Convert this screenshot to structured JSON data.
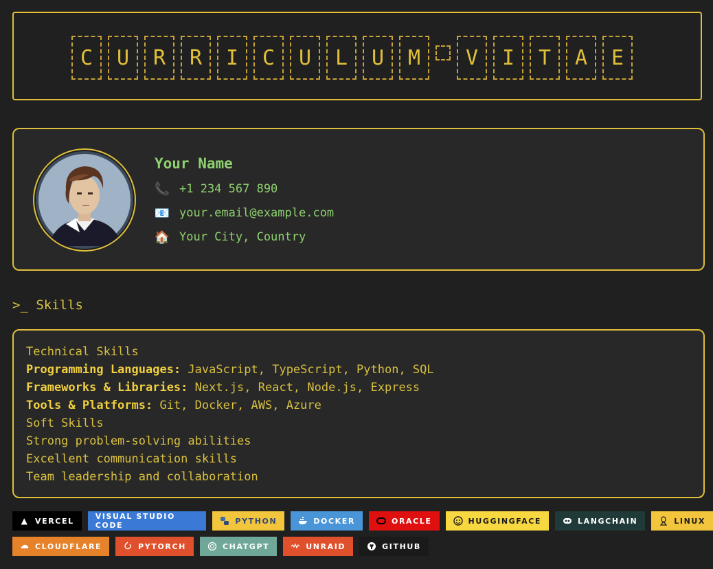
{
  "header": {
    "title_letters": [
      "C",
      "U",
      "R",
      "R",
      "I",
      "C",
      "U",
      "L",
      "U",
      "M",
      " ",
      "V",
      "I",
      "T",
      "A",
      "E"
    ]
  },
  "profile": {
    "name": "Your Name",
    "phone": "+1 234 567 890",
    "email": "your.email@example.com",
    "location": "Your City, Country",
    "phone_icon": "phone-icon",
    "email_icon": "envelope-icon",
    "location_icon": "house-icon"
  },
  "skills": {
    "heading": "Skills",
    "prompt_symbol": ">_",
    "lines": {
      "technical_title": "Technical Skills",
      "programming_label": "Programming Languages:",
      "programming_value": " JavaScript, TypeScript, Python, SQL",
      "frameworks_label": "Frameworks & Libraries:",
      "frameworks_value": " Next.js, React, Node.js, Express",
      "tools_label": "Tools & Platforms:",
      "tools_value": " Git, Docker, AWS, Azure",
      "soft_title": "Soft Skills",
      "soft_1": "Strong problem-solving abilities",
      "soft_2": "Excellent communication skills",
      "soft_3": "Team leadership and collaboration"
    }
  },
  "badges": {
    "row1": [
      {
        "label": "VERCEL",
        "bg": "#000000",
        "fg": "#ffffff",
        "icon": "triangle-icon"
      },
      {
        "label": "VISUAL STUDIO CODE",
        "bg": "#3a7ad6",
        "fg": "#ffffff",
        "icon": ""
      },
      {
        "label": "PYTHON",
        "bg": "#f2c53d",
        "fg": "#2f4a78",
        "icon": "python-icon"
      },
      {
        "label": "DOCKER",
        "bg": "#4a95d8",
        "fg": "#ffffff",
        "icon": "docker-icon"
      },
      {
        "label": "ORACLE",
        "bg": "#e01010",
        "fg": "#ffffff",
        "icon": "oracle-icon"
      },
      {
        "label": "HUGGINGFACE",
        "bg": "#f8d840",
        "fg": "#1a1a1a",
        "icon": "huggingface-icon"
      },
      {
        "label": "LANGCHAIN",
        "bg": "#1f3a38",
        "fg": "#ffffff",
        "icon": "langchain-icon"
      },
      {
        "label": "LINUX",
        "bg": "#f2c53d",
        "fg": "#1a1a1a",
        "icon": "linux-icon"
      }
    ],
    "row2": [
      {
        "label": "CLOUDFLARE",
        "bg": "#e5822a",
        "fg": "#ffffff",
        "icon": "cloud-icon"
      },
      {
        "label": "PYTORCH",
        "bg": "#e0502c",
        "fg": "#ffffff",
        "icon": "pytorch-icon"
      },
      {
        "label": "CHATGPT",
        "bg": "#6fa898",
        "fg": "#ffffff",
        "icon": "chatgpt-icon"
      },
      {
        "label": "UNRAID",
        "bg": "#e0502c",
        "fg": "#ffffff",
        "icon": "unraid-icon"
      },
      {
        "label": "GITHUB",
        "bg": "#1a1a1a",
        "fg": "#ffffff",
        "icon": "github-icon"
      }
    ]
  },
  "colors": {
    "accent": "#e0c03a",
    "name_green": "#8fd070",
    "background": "#202020",
    "panel": "#282828"
  }
}
